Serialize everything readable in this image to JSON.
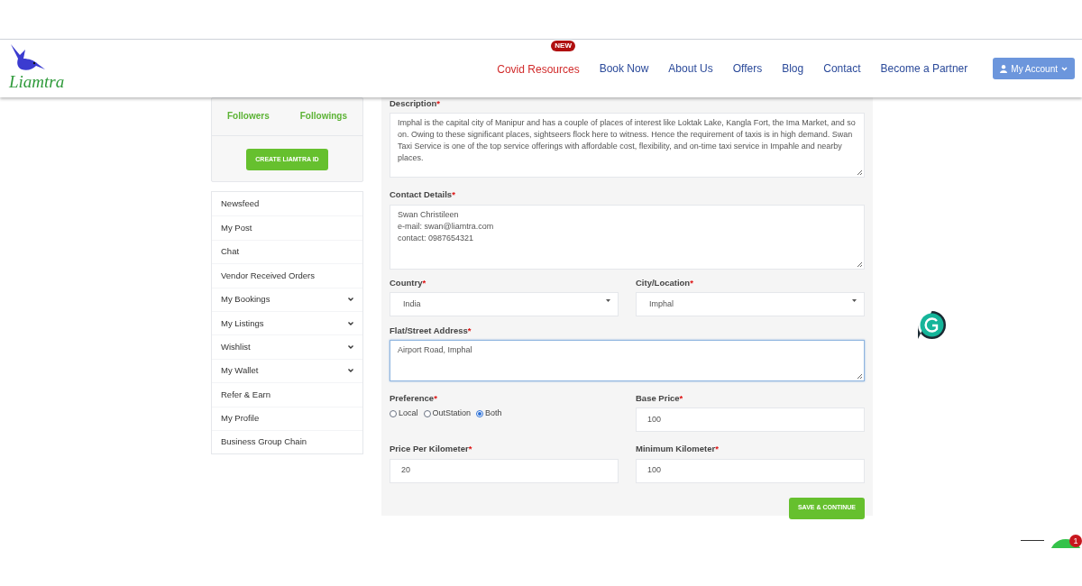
{
  "logo": {
    "name": "Liamtra"
  },
  "nav": [
    {
      "label": "Covid Resources",
      "badge": "NEW",
      "kind": "highlight"
    },
    {
      "label": "Book Now",
      "kind": "link"
    },
    {
      "label": "About Us",
      "kind": "link"
    },
    {
      "label": "Offers",
      "kind": "link"
    },
    {
      "label": "Blog",
      "kind": "link"
    },
    {
      "label": "Contact",
      "kind": "link"
    },
    {
      "label": "Become a Partner",
      "kind": "link"
    }
  ],
  "account_button": {
    "label": "My Account"
  },
  "profile": {
    "stats": [
      {
        "label": "Followers"
      },
      {
        "label": "Followings"
      }
    ],
    "create_button": "CREATE LIAMTRA ID"
  },
  "sidebar": {
    "items": [
      {
        "label": "Newsfeed",
        "expandable": false
      },
      {
        "label": "My Post",
        "expandable": false
      },
      {
        "label": "Chat",
        "expandable": false
      },
      {
        "label": "Vendor Received Orders",
        "expandable": false
      },
      {
        "label": "My Bookings",
        "expandable": true
      },
      {
        "label": "My Listings",
        "expandable": true
      },
      {
        "label": "Wishlist",
        "expandable": true
      },
      {
        "label": "My Wallet",
        "expandable": true
      },
      {
        "label": "Refer & Earn",
        "expandable": false
      },
      {
        "label": "My Profile",
        "expandable": false
      },
      {
        "label": "Business Group Chain",
        "expandable": false
      }
    ]
  },
  "form": {
    "required_mark": "*",
    "description": {
      "label": "Description",
      "value": "Imphal is the capital city of Manipur and has a couple of places of interest like Loktak Lake, Kangla Fort, the Ima Market, and so on. Owing to these significant places, sightseers flock here to witness. Hence the requirement of taxis is in high demand. Swan Taxi Service is one of the top service offerings with affordable cost, flexibility, and on-time taxi service in Impahle and nearby places."
    },
    "contact": {
      "label": "Contact Details",
      "value": "Swan Christileen\ne-mail: swan@liamtra.com\ncontact: 0987654321"
    },
    "country": {
      "label": "Country",
      "value": "India"
    },
    "city": {
      "label": "City/Location",
      "value": "Imphal"
    },
    "address": {
      "label": "Flat/Street Address",
      "value": "Airport Road, Imphal",
      "focused": true
    },
    "preference": {
      "label": "Preference",
      "options": [
        {
          "label": "Local",
          "selected": false
        },
        {
          "label": "OutStation",
          "selected": false
        },
        {
          "label": "Both",
          "selected": true
        }
      ]
    },
    "base_price": {
      "label": "Base Price",
      "value": "100"
    },
    "price_per_km": {
      "label": "Price Per Kilometer",
      "value": "20"
    },
    "min_km": {
      "label": "Minimum Kilometer",
      "value": "100"
    },
    "submit": "SAVE & CONTINUE"
  },
  "chat_widget": {
    "badge": "1"
  }
}
